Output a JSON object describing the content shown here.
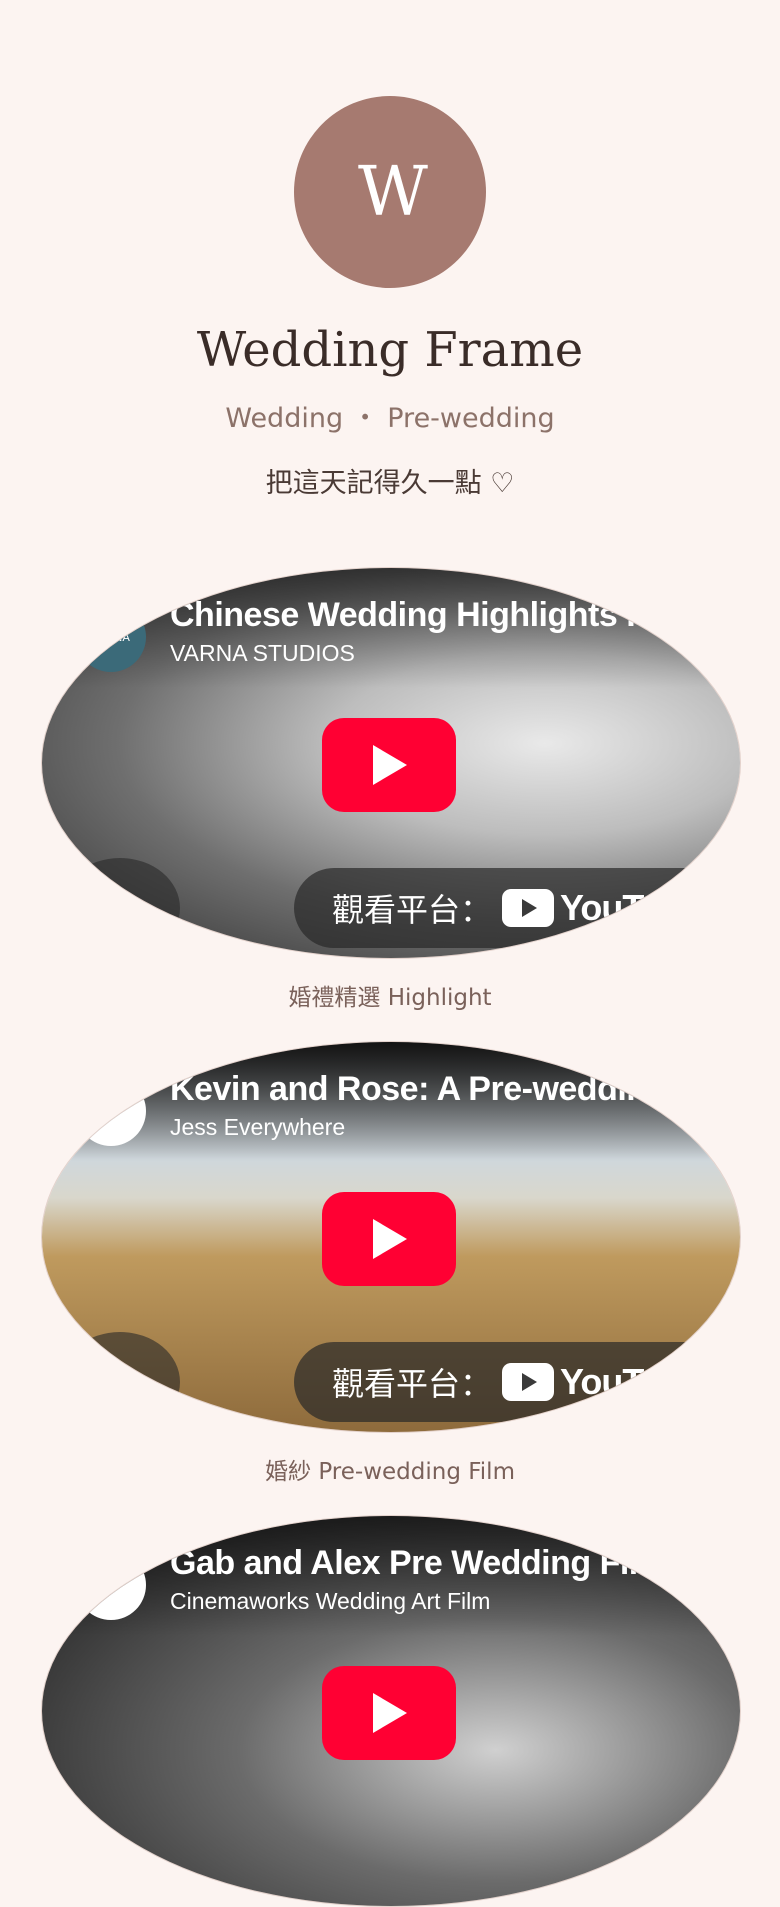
{
  "profile": {
    "avatar_letter": "W",
    "title": "Wedding Frame",
    "subtitle": "Wedding ・ Pre-wedding",
    "tagline": "把這天記得久一點 ♡"
  },
  "videos": [
    {
      "title": "Chinese Wedding Highlights Film",
      "channel": "VARNA STUDIOS",
      "channel_logo_text": "VARNA",
      "watch_label": "觀看平台：",
      "platform": "YouTube",
      "caption": "婚禮精選 Highlight",
      "play_icon": "youtube-play-icon",
      "share_icon": "share-icon"
    },
    {
      "title": "Kevin and Rose: A Pre-wedding Film",
      "channel": "Jess Everywhere",
      "channel_logo_text": "",
      "watch_label": "觀看平台：",
      "platform": "YouTube",
      "caption": "婚紗 Pre-wedding Film",
      "play_icon": "youtube-play-icon",
      "share_icon": "share-icon"
    },
    {
      "title": "Gab and Alex Pre Wedding Film",
      "channel": "Cinemaworks Wedding Art Film",
      "channel_logo_text": "",
      "play_icon": "youtube-play-icon"
    }
  ],
  "colors": {
    "background": "#fcf4f1",
    "avatar": "#a67a70",
    "youtube_red": "#ff0033"
  }
}
